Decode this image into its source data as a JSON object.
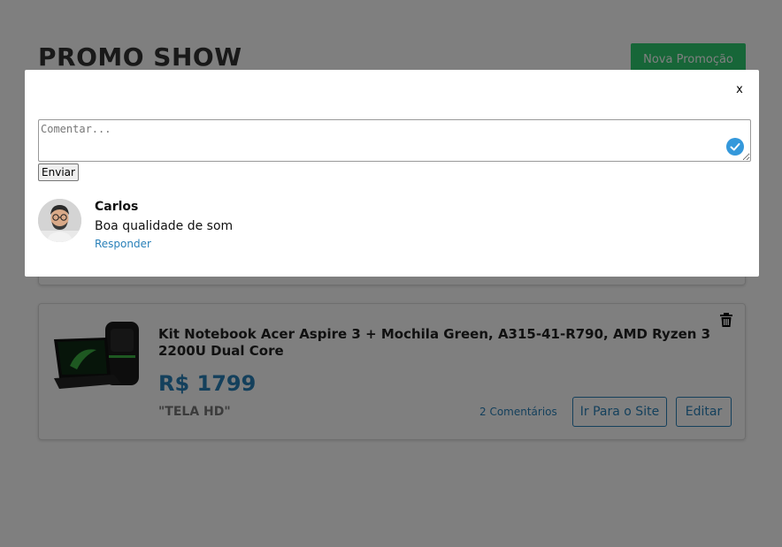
{
  "app": {
    "title": "PROMO SHOW",
    "new_promo_label": "Nova Promoção"
  },
  "promotion": {
    "title": "Kit Notebook Acer Aspire 3 + Mochila Green, A315-41-R790, AMD Ryzen 3 2200U Dual Core",
    "price": "R$ 1799",
    "comment": "\"TELA HD\"",
    "comments_count_label": "2 Comentários",
    "goto_site_label": "Ir Para o Site",
    "edit_label": "Editar",
    "image_icon": "laptop-backpack-image",
    "delete_icon": "trash-icon"
  },
  "modal": {
    "close_label": "x",
    "comment_placeholder": "Comentar...",
    "send_label": "Enviar",
    "comments": [
      {
        "author": "Carlos",
        "text": "Boa qualidade de som",
        "reply_label": "Responder"
      }
    ]
  },
  "colors": {
    "accent": "#2980b9",
    "success": "#2ecc71",
    "overlay": "rgba(0,0,0,0.5)"
  }
}
